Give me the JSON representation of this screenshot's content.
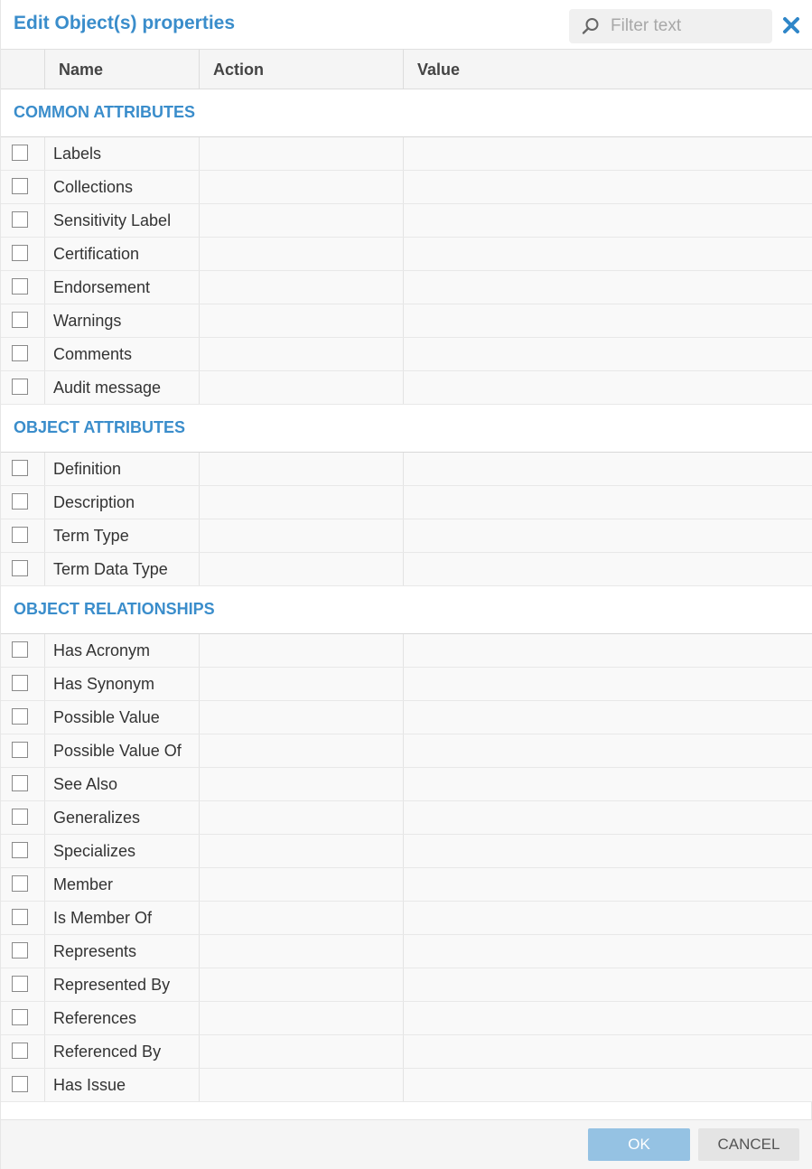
{
  "dialog": {
    "title": "Edit Object(s) properties",
    "filter_placeholder": "Filter text"
  },
  "columns": {
    "name": "Name",
    "action": "Action",
    "value": "Value"
  },
  "sections": [
    {
      "title": "COMMON ATTRIBUTES",
      "items": [
        "Labels",
        "Collections",
        "Sensitivity Label",
        "Certification",
        "Endorsement",
        "Warnings",
        "Comments",
        "Audit message"
      ]
    },
    {
      "title": "OBJECT ATTRIBUTES",
      "items": [
        "Definition",
        "Description",
        "Term Type",
        "Term Data Type"
      ]
    },
    {
      "title": "OBJECT RELATIONSHIPS",
      "items": [
        "Has Acronym",
        "Has Synonym",
        "Possible Value",
        "Possible Value Of",
        "See Also",
        "Generalizes",
        "Specializes",
        "Member",
        "Is Member Of",
        "Represents",
        "Represented By",
        "References",
        "Referenced By",
        "Has Issue"
      ]
    }
  ],
  "footer": {
    "ok_label": "OK",
    "cancel_label": "CANCEL"
  },
  "colors": {
    "accent": "#3a8dcb",
    "ok_button": "#95c2e3",
    "cancel_button": "#e4e4e4"
  },
  "icons": {
    "search": "search-icon",
    "close": "close-icon"
  }
}
